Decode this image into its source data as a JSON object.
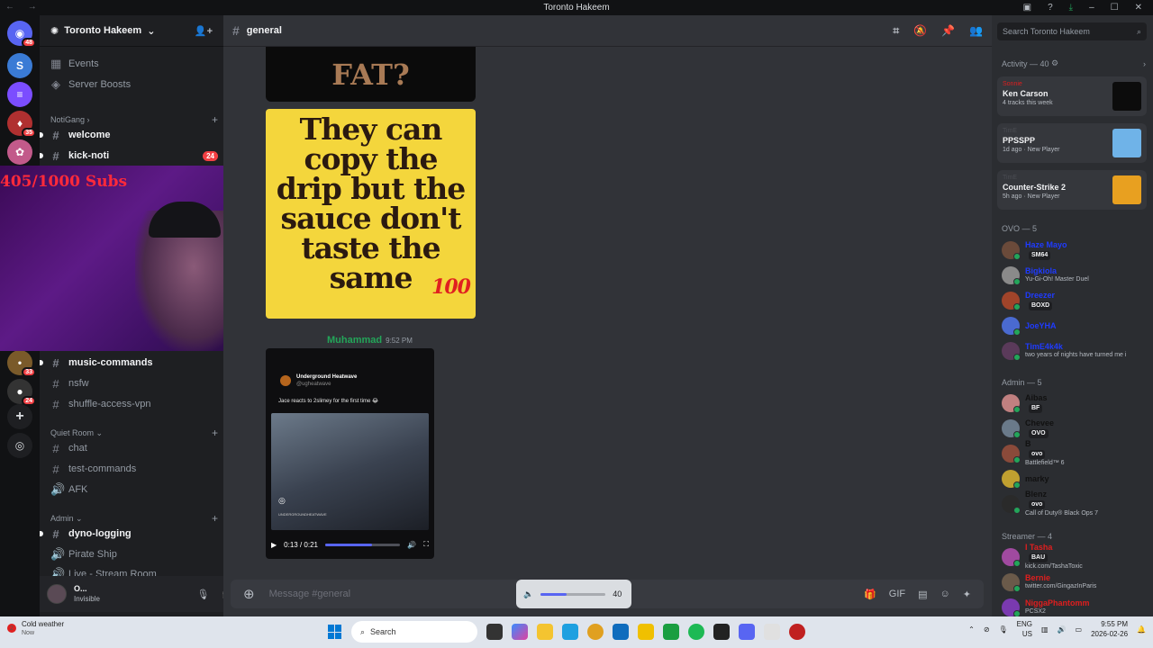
{
  "window": {
    "title": "Toronto Hakeem",
    "nav": "← →"
  },
  "servers": [
    {
      "badge": "48",
      "color": "#5865f2",
      "glyph": "◉"
    },
    {
      "badge": "",
      "color": "#3a7bd5",
      "glyph": "S"
    },
    {
      "badge": "",
      "color": "#7b4dff",
      "glyph": "≡"
    },
    {
      "badge": "35",
      "color": "#b03030",
      "glyph": "♦"
    },
    {
      "badge": "",
      "color": "#c25a8a",
      "glyph": "✿"
    },
    {
      "badge": "33",
      "color": "#7a5a2a",
      "glyph": "•"
    },
    {
      "badge": "24",
      "color": "#333",
      "glyph": "●"
    }
  ],
  "guild": {
    "name": "Toronto Hakeem"
  },
  "channels": {
    "events": "Events",
    "boosts": "Server Boosts",
    "cat_notigang": "NotiGang",
    "welcome": "welcome",
    "kick_noti": "kick-noti",
    "kick_noti_badge": "24",
    "music_commands": "music-commands",
    "nsfw": "nsfw",
    "shuffle": "shuffle-access-vpn",
    "cat_quiet": "Quiet Room",
    "chat": "chat",
    "test_commands": "test-commands",
    "afk": "AFK",
    "cat_admin": "Admin",
    "dyno_logging": "dyno-logging",
    "pirate_ship": "Pirate Ship",
    "live_stream": "Live - Stream Room"
  },
  "webcam": {
    "overlay_text": "405/1000 Subs"
  },
  "user": {
    "name": "O...",
    "status": "Invisible"
  },
  "chat": {
    "channel": "general",
    "image1_text": "FAT?",
    "image2_text": "They can copy the drip but the sauce don't taste the same",
    "image2_emoji": "100",
    "author": "Muhammad",
    "time": "9:52 PM",
    "embed": {
      "source": "Underground Heatwave",
      "handle": "@ugheatwave",
      "caption": "Jace reacts to 2slimey for the first time 😂",
      "watermark": "UNDERGROUNDHEATWAVE",
      "time_display": "0:13 / 0:21",
      "progress": 0.62
    },
    "composer_placeholder": "Message #general"
  },
  "volume": {
    "value": "40",
    "level": 0.4
  },
  "members": {
    "search_placeholder": "Search Toronto Hakeem",
    "activity_header": "Activity — 40",
    "activities": [
      {
        "who": "Sonnie",
        "title": "Ken Carson",
        "sub": "4 tracks this week",
        "thumb": "#111"
      },
      {
        "who": "TimE",
        "title": "PPSSPP",
        "sub": "1d ago  ·  New Player",
        "thumb": "#3a8fd0"
      },
      {
        "who": "TimE",
        "title": "Counter-Strike 2",
        "sub": "5h ago  ·  New Player",
        "thumb": "#e0a020"
      }
    ],
    "ovo_header": "OVO — 5",
    "ovo": [
      {
        "name": "Haze Mayo",
        "tag": "SM64",
        "sub": "",
        "color": "#1f3bff",
        "av": "#6a4a3a"
      },
      {
        "name": "Bigkiola",
        "tag": "",
        "sub": "Yu-Gi-Oh! Master Duel",
        "color": "#1f3bff",
        "av": "#8a8a8a"
      },
      {
        "name": "Dreezer",
        "tag": "BOXD",
        "sub": "",
        "color": "#1f3bff",
        "av": "#a0442a"
      },
      {
        "name": "JoeYHA",
        "tag": "",
        "sub": "",
        "color": "#1f3bff",
        "av": "#4a6ad0"
      },
      {
        "name": "TimE4k4k",
        "tag": "",
        "sub": "two years of nights have turned me i",
        "color": "#1f3bff",
        "av": "#5a3a5a"
      }
    ],
    "admin_header": "Admin — 5",
    "admin": [
      {
        "name": "Aibas",
        "tag": "BF",
        "sub": "",
        "color": "#111",
        "av": "#c08080"
      },
      {
        "name": "Chevee",
        "tag": "OVO",
        "sub": "",
        "color": "#111",
        "av": "#6a7a8a"
      },
      {
        "name": "B",
        "tag": "ovo",
        "sub": "Battlefield™ 6",
        "color": "#111",
        "av": "#8a4a3a"
      },
      {
        "name": "marky",
        "tag": "",
        "sub": "",
        "color": "#111",
        "av": "#c0a030"
      },
      {
        "name": "Blenz",
        "tag": "ovo",
        "sub": "Call of Duty® Black Ops 7",
        "color": "#111",
        "av": "#2a2a2a"
      }
    ],
    "streamer_header": "Streamer — 4",
    "streamer": [
      {
        "name": "I Tasha",
        "tag": "BAU",
        "sub": "kick.com/TashaToxic",
        "color": "#e01e1e",
        "av": "#a04aa0"
      },
      {
        "name": "Bernie",
        "tag": "",
        "sub": "twitter.com/GingazInParis",
        "color": "#e01e1e",
        "av": "#6a5a4a"
      },
      {
        "name": "NiggaPhantomm",
        "tag": "",
        "sub": "PCSX2",
        "color": "#e01e1e",
        "av": "#7a3ab0"
      }
    ]
  },
  "taskbar": {
    "weather": "Cold weather",
    "weather_sub": "Now",
    "weather_badge": "2",
    "search": "Search",
    "lang": "ENG",
    "region": "US",
    "time": "9:55 PM",
    "date": "2026-02-26"
  }
}
